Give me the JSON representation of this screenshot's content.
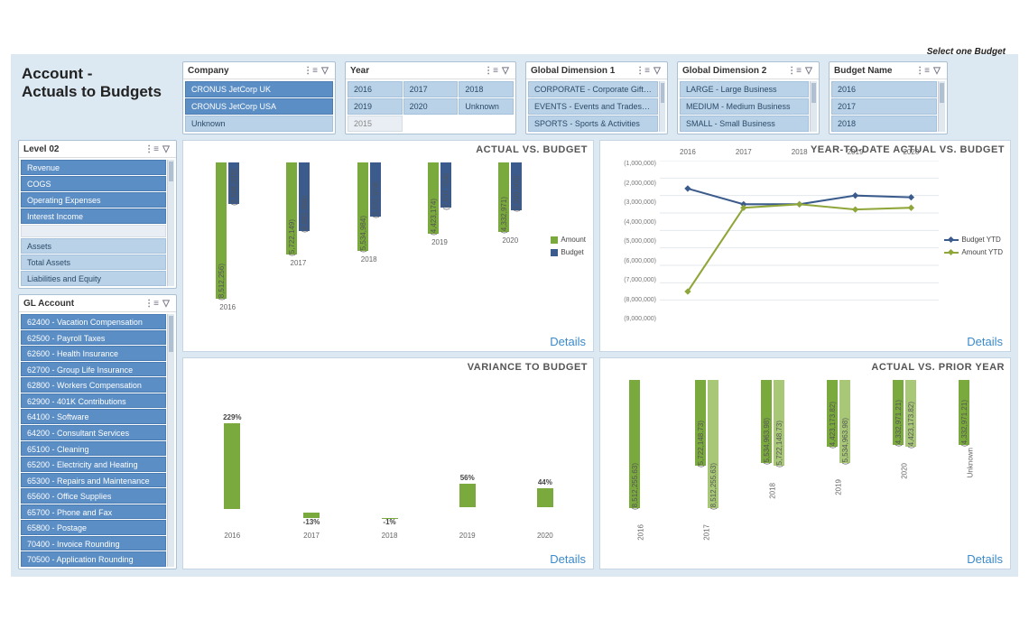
{
  "title_line1": "Account -",
  "title_line2": "Actuals to Budgets",
  "budget_note": "Select one Budget",
  "slicers": {
    "company": {
      "title": "Company",
      "items": [
        "CRONUS JetCorp UK",
        "CRONUS JetCorp USA",
        "Unknown"
      ]
    },
    "year": {
      "title": "Year",
      "grid": [
        "2016",
        "2017",
        "2018",
        "2019",
        "2020",
        "Unknown",
        "2015"
      ]
    },
    "gd1": {
      "title": "Global Dimension 1",
      "items": [
        "CORPORATE - Corporate Gift…",
        "EVENTS - Events and Trades…",
        "SPORTS - Sports & Activities"
      ]
    },
    "gd2": {
      "title": "Global Dimension 2",
      "items": [
        "LARGE - Large Business",
        "MEDIUM - Medium Business",
        "SMALL - Small Business"
      ]
    },
    "budget": {
      "title": "Budget Name",
      "items": [
        "2016",
        "2017",
        "2018"
      ]
    },
    "level02": {
      "title": "Level 02",
      "items": [
        "Revenue",
        "COGS",
        "Operating Expenses",
        "Interest Income",
        "",
        "Assets",
        "Total Assets",
        "Liabilities and Equity"
      ]
    },
    "gl": {
      "title": "GL Account",
      "items": [
        "62400 - Vacation Compensation",
        "62500 - Payroll Taxes",
        "62600 - Health Insurance",
        "62700 - Group Life Insurance",
        "62800 - Workers Compensation",
        "62900 - 401K Contributions",
        "64100 - Software",
        "64200 - Consultant Services",
        "65100 - Cleaning",
        "65200 - Electricity and Heating",
        "65300 - Repairs and Maintenance",
        "65600 - Office Supplies",
        "65700 - Phone and Fax",
        "65800 - Postage",
        "70400 - Invoice Rounding",
        "70500 - Application Rounding"
      ]
    }
  },
  "chart_titles": {
    "avb": "ACTUAL VS. BUDGET",
    "ytd": "YEAR-TO-DATE ACTUAL VS. BUDGET",
    "var": "VARIANCE TO BUDGET",
    "prior": "ACTUAL VS. PRIOR YEAR"
  },
  "details_label": "Details",
  "legends": {
    "avb": [
      "Amount",
      "Budget"
    ],
    "ytd": [
      "Budget YTD",
      "Amount YTD"
    ]
  },
  "chart_data": [
    {
      "id": "actual_vs_budget",
      "type": "bar",
      "title": "ACTUAL VS. BUDGET",
      "categories": [
        "2016",
        "2017",
        "2018",
        "2019",
        "2020"
      ],
      "series": [
        {
          "name": "Amount",
          "values": [
            -8512256,
            -5722149,
            -5534984,
            -4423174,
            -4332971
          ],
          "labels": [
            "(8,512,256)",
            "(5,722,149)",
            "(5,534,984)",
            "(4,423,174)",
            "(4,332,971)"
          ]
        },
        {
          "name": "Budget",
          "values": [
            -2585025,
            -4282356,
            -3372974,
            -2837754,
            -2999006
          ],
          "labels": [
            "(2,585,025)",
            "(4,282,356)",
            "(3,372,974)",
            "(2,837,754)",
            "(2,999,006)"
          ]
        }
      ],
      "ylim": [
        -9000000,
        0
      ]
    },
    {
      "id": "ytd_actual_vs_budget",
      "type": "line",
      "title": "YEAR-TO-DATE ACTUAL VS. BUDGET",
      "x": [
        "2016",
        "2017",
        "2018",
        "2019",
        "2020"
      ],
      "series": [
        {
          "name": "Budget YTD",
          "values": [
            -2600000,
            -3500000,
            -3500000,
            -3000000,
            -3100000
          ]
        },
        {
          "name": "Amount YTD",
          "values": [
            -8500000,
            -3700000,
            -3500000,
            -3800000,
            -3700000
          ]
        }
      ],
      "y_ticks": [
        "(1,000,000)",
        "(2,000,000)",
        "(3,000,000)",
        "(4,000,000)",
        "(5,000,000)",
        "(6,000,000)",
        "(7,000,000)",
        "(8,000,000)",
        "(9,000,000)"
      ],
      "ylim": [
        -9000000,
        -1000000
      ]
    },
    {
      "id": "variance_to_budget",
      "type": "bar",
      "title": "VARIANCE TO BUDGET",
      "categories": [
        "2016",
        "2017",
        "2018",
        "2019",
        "2020"
      ],
      "values": [
        229,
        -13,
        -1,
        56,
        44
      ],
      "labels": [
        "229%",
        "-13%",
        "-1%",
        "56%",
        "44%"
      ],
      "ylim": [
        -50,
        250
      ]
    },
    {
      "id": "actual_vs_prior_year",
      "type": "bar",
      "title": "ACTUAL VS. PRIOR YEAR",
      "categories": [
        "2016",
        "2017",
        "2018",
        "2019",
        "2020",
        "Unknown"
      ],
      "series": [
        {
          "name": "Current",
          "values": [
            -8512255.63,
            -5722148.73,
            -5534963.98,
            -4423173.82,
            -4332971.21,
            -4332971.21
          ],
          "labels": [
            "(8,512,255.63)",
            "(5,722,148.73)",
            "(5,534,963.98)",
            "(4,423,173.82)",
            "(4,332,971.21)",
            "(4,332,971.21)"
          ]
        },
        {
          "name": "Prior",
          "values": [
            null,
            -8512255.63,
            -5722148.73,
            -5534963.98,
            -4423173.82,
            null
          ],
          "labels": [
            "",
            "(8,512,255.63)",
            "(5,722,148.73)",
            "(5,534,963.98)",
            "(4,423,173.82)",
            ""
          ]
        }
      ],
      "ylim": [
        -9000000,
        0
      ]
    }
  ]
}
